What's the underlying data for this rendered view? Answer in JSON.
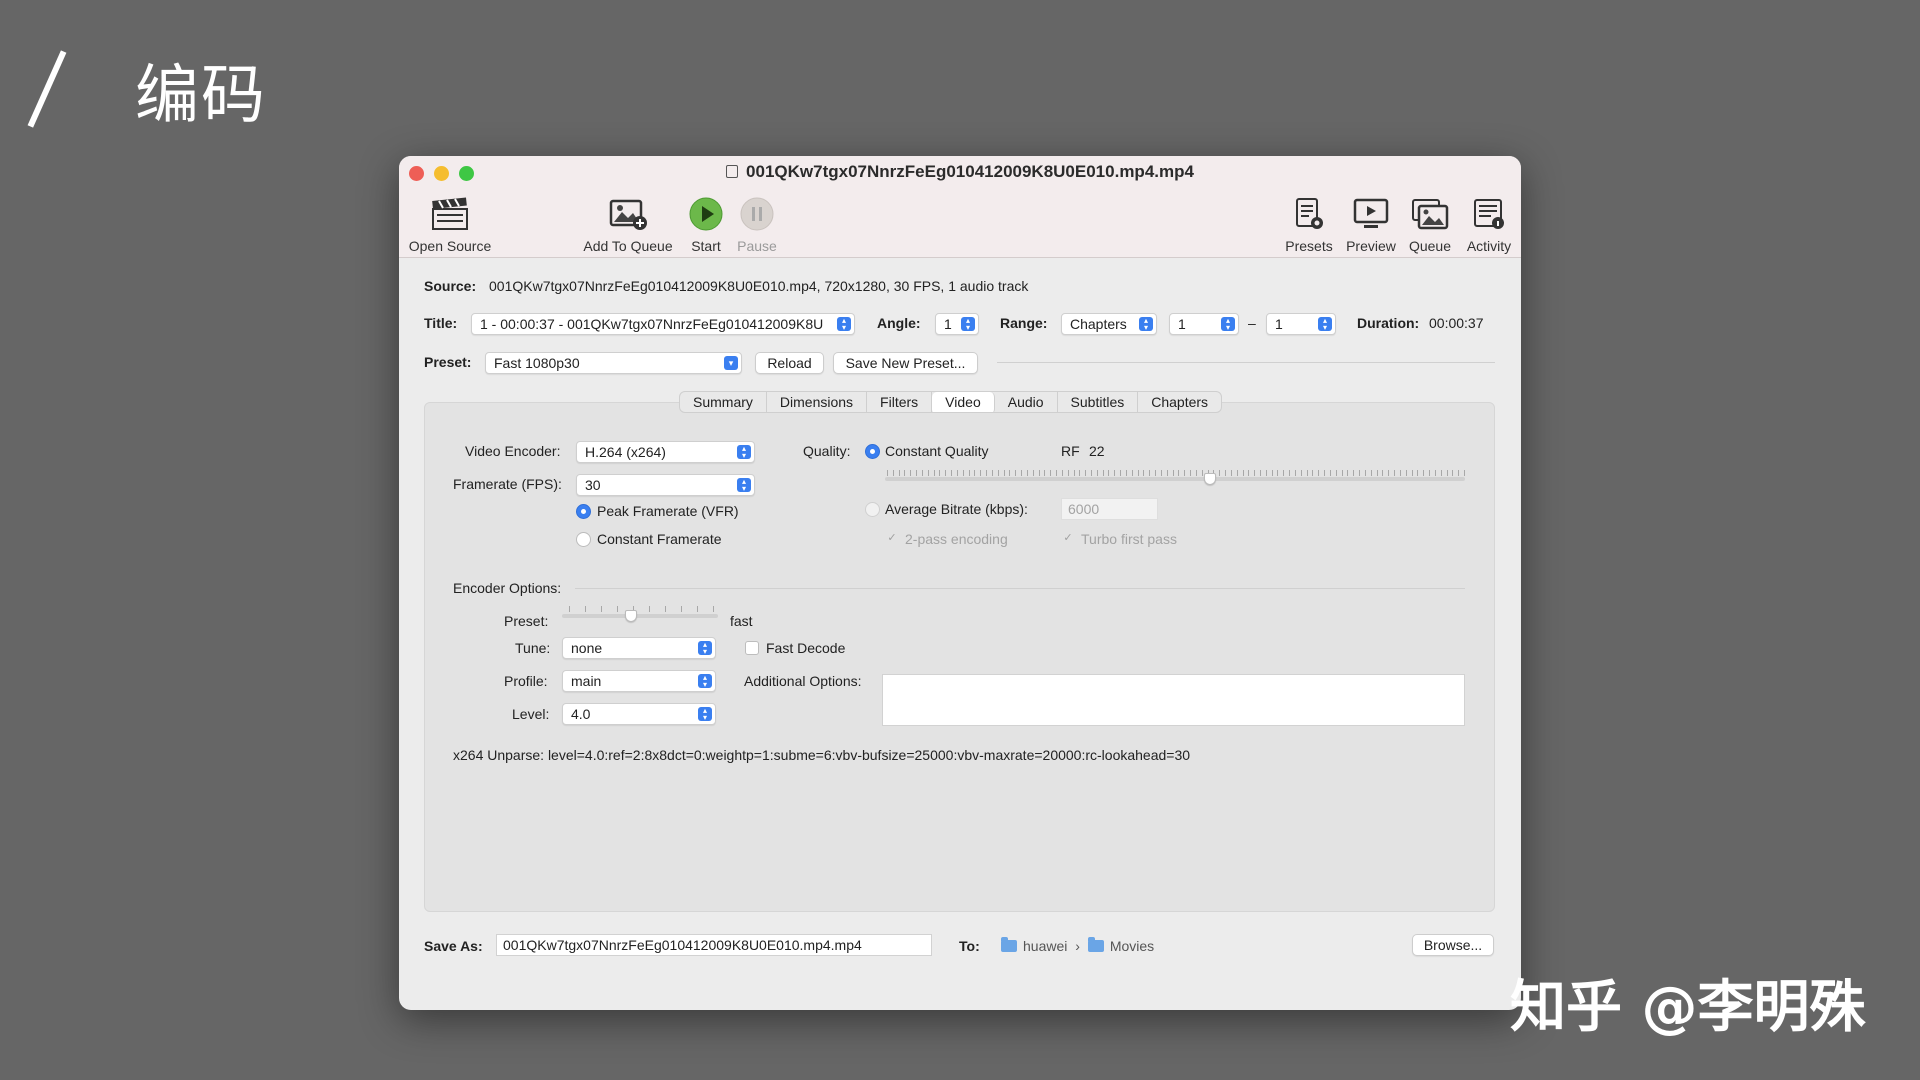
{
  "slide": {
    "title": "编码",
    "watermark": "知乎 @李明殊"
  },
  "window": {
    "title": "001QKw7tgx07NnrzFeEg010412009K8U0E010.mp4.mp4"
  },
  "toolbar": {
    "open_source": "Open Source",
    "add_to_queue": "Add To Queue",
    "start": "Start",
    "pause": "Pause",
    "presets": "Presets",
    "preview": "Preview",
    "queue": "Queue",
    "activity": "Activity"
  },
  "source": {
    "label": "Source:",
    "value": "001QKw7tgx07NnrzFeEg010412009K8U0E010.mp4, 720x1280, 30 FPS, 1 audio track"
  },
  "title_row": {
    "title_label": "Title:",
    "title_value": "1 - 00:00:37 - 001QKw7tgx07NnrzFeEg010412009K8U",
    "angle_label": "Angle:",
    "angle_value": "1",
    "range_label": "Range:",
    "range_value": "Chapters",
    "range_start": "1",
    "range_dash": "–",
    "range_end": "1",
    "duration_label": "Duration:",
    "duration_value": "00:00:37"
  },
  "preset_row": {
    "label": "Preset:",
    "value": "Fast 1080p30",
    "reload": "Reload",
    "save_new": "Save New Preset..."
  },
  "tabs": [
    "Summary",
    "Dimensions",
    "Filters",
    "Video",
    "Audio",
    "Subtitles",
    "Chapters"
  ],
  "active_tab": "Video",
  "video": {
    "encoder_label": "Video Encoder:",
    "encoder_value": "H.264 (x264)",
    "framerate_label": "Framerate (FPS):",
    "framerate_value": "30",
    "peak_framerate": "Peak Framerate (VFR)",
    "constant_framerate": "Constant Framerate",
    "quality_label": "Quality:",
    "constant_quality": "Constant Quality",
    "rf_label": "RF",
    "rf_value": "22",
    "rf_slider_fraction": 0.56,
    "avg_bitrate": "Average Bitrate (kbps):",
    "bitrate_placeholder": "6000",
    "two_pass": "2-pass encoding",
    "turbo": "Turbo first pass"
  },
  "encoder_options": {
    "heading": "Encoder Options:",
    "preset_label": "Preset:",
    "preset_value": "fast",
    "preset_slider_fraction": 0.44,
    "tune_label": "Tune:",
    "tune_value": "none",
    "fast_decode": "Fast Decode",
    "profile_label": "Profile:",
    "profile_value": "main",
    "additional_label": "Additional Options:",
    "level_label": "Level:",
    "level_value": "4.0",
    "unparse": "x264 Unparse: level=4.0:ref=2:8x8dct=0:weightp=1:subme=6:vbv-bufsize=25000:vbv-maxrate=20000:rc-lookahead=30"
  },
  "save": {
    "label": "Save As:",
    "value": "001QKw7tgx07NnrzFeEg010412009K8U0E010.mp4.mp4",
    "to_label": "To:",
    "folder1": "huawei",
    "chevron": "›",
    "folder2": "Movies",
    "browse": "Browse..."
  }
}
